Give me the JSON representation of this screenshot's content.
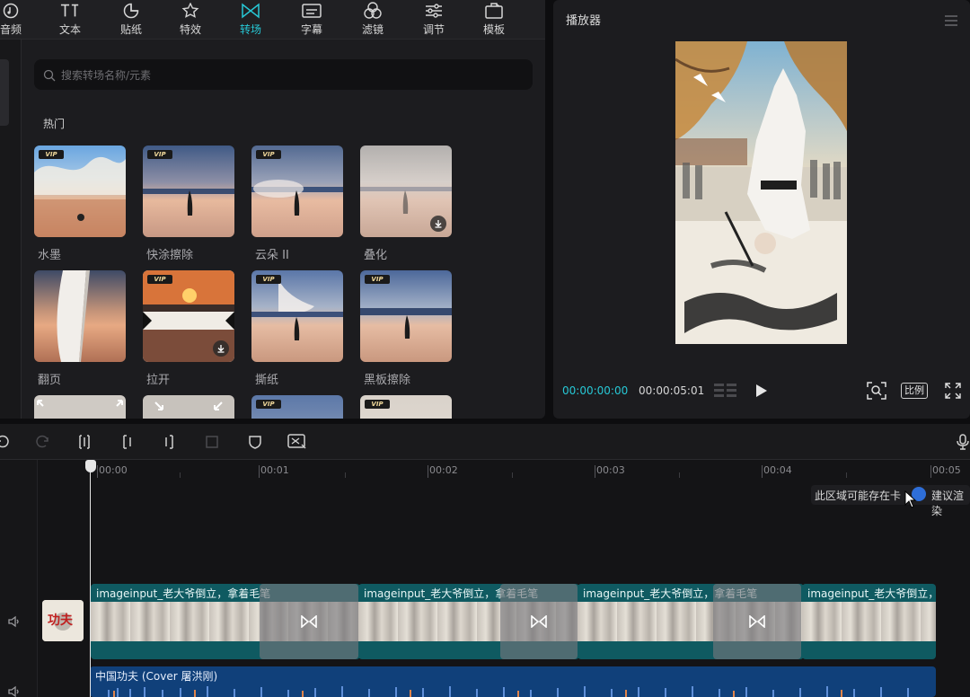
{
  "toolbar": {
    "items": [
      {
        "label": "音频",
        "icon": "audio-icon"
      },
      {
        "label": "文本",
        "icon": "text-icon"
      },
      {
        "label": "贴纸",
        "icon": "sticker-icon"
      },
      {
        "label": "特效",
        "icon": "effects-icon"
      },
      {
        "label": "转场",
        "icon": "transition-icon",
        "active": true
      },
      {
        "label": "字幕",
        "icon": "subtitle-icon"
      },
      {
        "label": "滤镜",
        "icon": "filter-icon"
      },
      {
        "label": "调节",
        "icon": "adjust-icon"
      },
      {
        "label": "模板",
        "icon": "template-icon"
      }
    ]
  },
  "search": {
    "placeholder": "搜索转场名称/元素"
  },
  "section": {
    "title": "热门"
  },
  "transitions": [
    {
      "label": "水墨",
      "vip": true,
      "download": false
    },
    {
      "label": "快涂擦除",
      "vip": true,
      "download": false
    },
    {
      "label": "云朵 II",
      "vip": true,
      "download": false
    },
    {
      "label": "叠化",
      "vip": false,
      "download": true
    },
    {
      "label": "翻页",
      "vip": false,
      "download": false
    },
    {
      "label": "拉开",
      "vip": true,
      "download": true
    },
    {
      "label": "撕纸",
      "vip": true,
      "download": false
    },
    {
      "label": "黑板擦除",
      "vip": true,
      "download": false
    },
    {
      "label": "",
      "vip": false,
      "download": false
    },
    {
      "label": "",
      "vip": false,
      "download": false
    },
    {
      "label": "",
      "vip": true,
      "download": false
    },
    {
      "label": "",
      "vip": true,
      "download": false
    }
  ],
  "vip_badge": "VIP",
  "player": {
    "title": "播放器",
    "current_time": "00:00:00:00",
    "total_time": "00:00:05:01",
    "ratio_label": "比例"
  },
  "timeline": {
    "ruler_labels": [
      "00:00",
      "00:01",
      "00:02",
      "00:03",
      "00:04",
      "00:05"
    ],
    "tooltip_left": "此区域可能存在卡",
    "tooltip_right": "建议渲染",
    "clips": [
      {
        "label": "imageinput_老大爷倒立，拿着毛笔"
      },
      {
        "label": "imageinput_老大爷倒立，拿着毛笔"
      },
      {
        "label": "imageinput_老大爷倒立，拿着毛笔"
      },
      {
        "label": "imageinput_老大爷倒立，拿着"
      }
    ],
    "cover_text": "功夫",
    "audio_label": "中国功夫 (Cover 屠洪刚)"
  },
  "colors": {
    "accent": "#27c8d6",
    "clip": "#0f5a61",
    "audio": "#10407a",
    "panel": "#1c1c1f"
  }
}
